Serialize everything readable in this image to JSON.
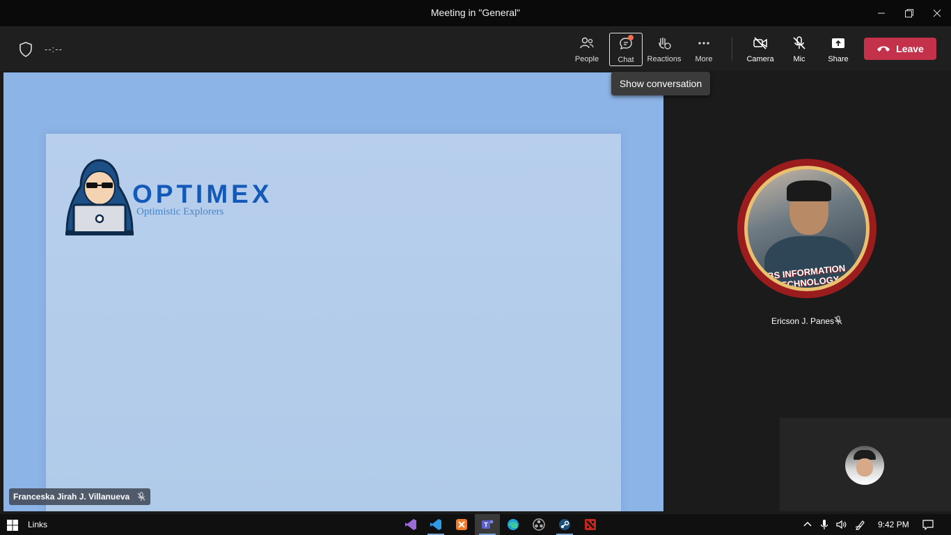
{
  "window": {
    "title": "Meeting in \"General\"",
    "minimize_icon": "minimize-icon",
    "maximize_icon": "restore-icon",
    "close_icon": "close-icon"
  },
  "toolbar": {
    "timer": "--:--",
    "buttons": [
      {
        "label": "People",
        "icon": "people-icon"
      },
      {
        "label": "Chat",
        "icon": "chat-icon",
        "active": true,
        "notification": true
      },
      {
        "label": "Reactions",
        "icon": "reactions-icon"
      },
      {
        "label": "More",
        "icon": "more-icon"
      },
      {
        "label": "Camera",
        "icon": "camera-off-icon"
      },
      {
        "label": "Mic",
        "icon": "mic-off-icon"
      },
      {
        "label": "Share",
        "icon": "share-icon"
      }
    ],
    "leave_label": "Leave",
    "leave_color": "#c4314b"
  },
  "tooltip": "Show conversation",
  "shared_screen": {
    "logo_title": "OPTIMEX",
    "logo_subtitle": "Optimistic Explorers",
    "presenter": "Franceska Jirah J. Villanueva",
    "presenter_muted": true
  },
  "participants": [
    {
      "name": "Ericson J. Panes",
      "muted": true,
      "badge_text": "BS INFORMATION TECHNOLOGY"
    }
  ],
  "taskbar": {
    "links_label": "Links",
    "apps": [
      "visual-studio-icon",
      "vscode-icon",
      "xampp-icon",
      "teams-icon",
      "edge-icon",
      "obs-icon",
      "steam-icon",
      "dota-icon"
    ],
    "clock": "9:42 PM"
  }
}
